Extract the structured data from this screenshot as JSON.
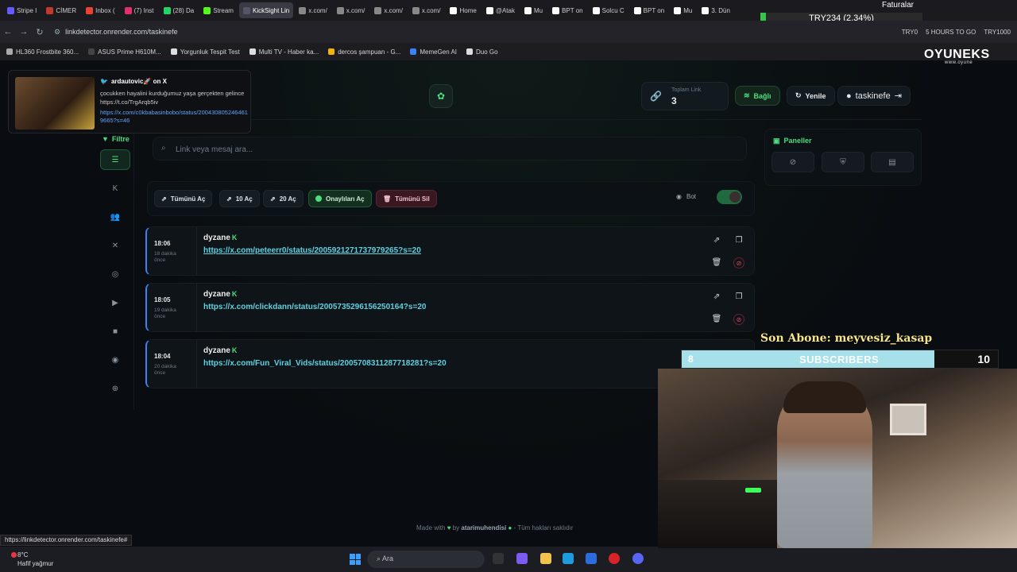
{
  "browser": {
    "tabs": [
      {
        "label": "Stripe I",
        "color": "#635bff"
      },
      {
        "label": "CİMER",
        "color": "#c0392b"
      },
      {
        "label": "Inbox (",
        "color": "#ea4335"
      },
      {
        "label": "(7) Inst",
        "color": "#e1306c"
      },
      {
        "label": "(28) Da",
        "color": "#25d366"
      },
      {
        "label": "Stream",
        "color": "#53fc18"
      },
      {
        "label": "KickSight Lin",
        "color": "#556"
      },
      {
        "label": "x.com/",
        "color": "#888"
      },
      {
        "label": "x.com/",
        "color": "#888"
      },
      {
        "label": "x.com/",
        "color": "#888"
      },
      {
        "label": "x.com/",
        "color": "#888"
      },
      {
        "label": "Home",
        "color": "#fff"
      },
      {
        "label": "@Atak",
        "color": "#fff"
      },
      {
        "label": "Mu",
        "color": "#fff"
      },
      {
        "label": "BPT on",
        "color": "#fff"
      },
      {
        "label": "Solcu C",
        "color": "#fff"
      },
      {
        "label": "BPT on",
        "color": "#fff"
      },
      {
        "label": "Mu",
        "color": "#fff"
      },
      {
        "label": "3. Dün",
        "color": "#fff"
      }
    ],
    "active_tab_index": 6,
    "ticker_top": "Faturalar",
    "ticker_price": "TRY234 (2.34%)",
    "url": "linkdetector.onrender.com/taskinefe",
    "addr_right": [
      "TRY0",
      "5 HOURS TO GO",
      "TRY1000"
    ],
    "bookmarks": [
      {
        "label": "HL360 Frostbite 360...",
        "color": "#aaa"
      },
      {
        "label": "ASUS Prime H610M...",
        "color": "#444"
      },
      {
        "label": "Yorgunluk Tespit Test",
        "color": "#ddd"
      },
      {
        "label": "Multi TV - Haber ka...",
        "color": "#ddd"
      },
      {
        "label": "dercos şampuan - G...",
        "color": "#f4b400"
      },
      {
        "label": "MemeGen AI",
        "color": "#3b82f6"
      },
      {
        "label": "Duo Go",
        "color": "#ddd"
      }
    ]
  },
  "notification": {
    "author": "ardautovic🚀 on X",
    "message": "çocukken hayalini kurduğumuz yaşa gerçekten gelince https://t.co/TrgArqb5iv",
    "link": "https://x.com/c0kbabasinbobo/status/2004308052464619665?s=46"
  },
  "header": {
    "stat_label": "Toplam Link",
    "stat_value": "3",
    "connected_label": "Bağlı",
    "refresh_label": "Yenile",
    "username": "taskinefe"
  },
  "sidebar": {
    "filter_label": "Filtre",
    "items": [
      {
        "icon": "list-icon",
        "glyph": "☰"
      },
      {
        "icon": "kick-icon",
        "glyph": "K"
      },
      {
        "icon": "users-icon",
        "glyph": "👥"
      },
      {
        "icon": "x-icon",
        "glyph": "✕"
      },
      {
        "icon": "instagram-icon",
        "glyph": "◎"
      },
      {
        "icon": "youtube-icon",
        "glyph": "▶"
      },
      {
        "icon": "video-icon",
        "glyph": "■"
      },
      {
        "icon": "camera-icon",
        "glyph": "◉"
      },
      {
        "icon": "globe-icon",
        "glyph": "⊕"
      }
    ]
  },
  "search": {
    "placeholder": "Link veya mesaj ara...",
    "value": ""
  },
  "toolbar": {
    "open_all": "Tümünü Aç",
    "open_10": "10 Aç",
    "open_20": "20 Aç",
    "open_approved": "Onaylıları Aç",
    "delete_all": "Tümünü Sil",
    "bot_label": "Bot",
    "bot_enabled": true
  },
  "links": [
    {
      "time": "18:06",
      "ago": "18 dakika önce",
      "user": "dyzane",
      "url": "https://x.com/peteerr0/status/2005921271737979265?s=20"
    },
    {
      "time": "18:05",
      "ago": "19 dakika önce",
      "user": "dyzane",
      "url": "https://x.com/clickdann/status/2005735296156250164?s=20"
    },
    {
      "time": "18:04",
      "ago": "20 dakika önce",
      "user": "dyzane",
      "url": "https://x.com/Fun_Viral_Vids/status/2005708311287718281?s=20"
    }
  ],
  "panels": {
    "title": "Paneller"
  },
  "footer": {
    "made_with": "Made with",
    "by": "by",
    "author": "atarimuhendisi",
    "rights": "- Tüm hakları saklıdır"
  },
  "status_url": "https://linkdetector.onrender.com/taskinefe#",
  "taskbar": {
    "temp": "8°C",
    "weather": "Hafif yağmur",
    "search": "Ara"
  },
  "overlay": {
    "brand": "OYUNEKS",
    "brand_sub": "www.oyune",
    "last_sub": "Son Abone: meyvesiz_kasap",
    "sub_current": "8",
    "sub_label": "SUBSCRIBERS",
    "sub_goal": "10",
    "sub_progress": 0.8
  }
}
